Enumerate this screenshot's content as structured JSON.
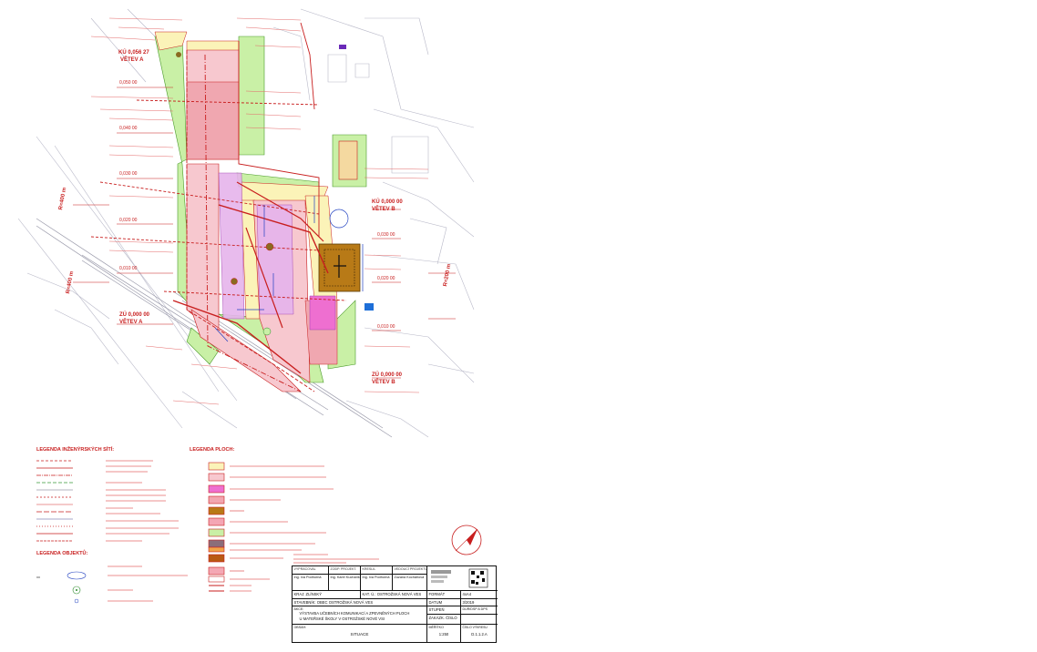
{
  "plan": {
    "labels": {
      "ku_a": "KÚ 0,056 27",
      "vetev_a": "VĚTEV A",
      "ku_b": "KÚ 0,000 00",
      "vetev_b": "VĚTEV B",
      "zu_a": "ZÚ 0,000 00",
      "zu_vetev_a": "VĚTEV A",
      "zu_b": "ZÚ 0,000 00",
      "zu_vetev_b": "VĚTEV B",
      "st_050": "0,050 00",
      "st_040": "0,040 00",
      "st_030": "0,030 00",
      "st_020": "0,020 00",
      "st_010": "0,010 00",
      "st_b030": "0,030 00",
      "st_b020": "0,020 00",
      "st_b010": "0,010 00",
      "r_400_a": "R=400 m",
      "r_400_b": "R=400 m",
      "r_200": "R=200 m"
    }
  },
  "legend_networks": {
    "title": "LEGENDA INŽENÝRSKÝCH SÍTÍ:"
  },
  "legend_areas": {
    "title": "LEGENDA PLOCH:",
    "items": [
      {
        "color": "#fbf3b8"
      },
      {
        "color": "#f7c8cf"
      },
      {
        "color": "#ee6fd0"
      },
      {
        "color": "#f2a6b0"
      },
      {
        "color": "#b87a17"
      },
      {
        "color": "#f4a6b4"
      },
      {
        "color": "#c9f0a6"
      },
      {
        "color": "#8a6e7a"
      },
      {
        "color": "#f0a44a"
      },
      {
        "color": "#b85a14"
      },
      {
        "color": "#f4a8b4"
      }
    ]
  },
  "legend_objects": {
    "title": "LEGENDA OBJEKTŮ:"
  },
  "title_block": {
    "row1": [
      "VYPRACOVAL",
      "ZODP. PROJEKT.",
      "KRESLIL",
      "VEDOUCÍ PROJEKTU"
    ],
    "row2": [
      "Ing. Iva Podhorná",
      "Ing. Karel Kucharík",
      "Ing. Iva Podhorná",
      "Zuzana Kocháňová"
    ],
    "kraj_label": "KRAJ: ZLÍNSKÝ",
    "ku_label": "KAT. Ú.: OSTROŽSKÁ NOVÁ VES",
    "formát_label": "FORMÁT",
    "format_value": "4xA4",
    "investor_label": "STAVEBNÍK: OBEC OSTROŽSKÁ NOVÁ VES",
    "datum_label": "DATUM",
    "datum_value": "3/2019",
    "akce_label": "AKCE:",
    "akce_value_1": "VÝSTAVBA UČEBNÍCH KOMUNIKACÍ A ZPEVNĚNÝCH PLOCH",
    "akce_value_2": "U MATEŘSKÉ ŠKOLY V OSTROŽSKÉ NOVÉ VSI",
    "stupen_label": "STUPEŇ",
    "stupen_value": "DUR/DSP A DPS",
    "zakazka_label": "ZAKÁZK. ČÍSLO",
    "obsah_label": "OBSAH:",
    "obsah_value": "SITUACE",
    "meritko_label": "MĚŘÍTKO",
    "meritko_value": "1:250",
    "cislo_label": "ČÍSLO VÝKRESU",
    "cislo_value": "D.1.1.2.A"
  },
  "colors": {
    "red": "#c81e1e",
    "yellow_area": "#fbf3b8",
    "pink_area": "#f7c8cf",
    "magenta_area": "#ee6fd0",
    "green_area": "#c9f0a6",
    "brown_area": "#b87a17",
    "blue": "#2040c0"
  }
}
